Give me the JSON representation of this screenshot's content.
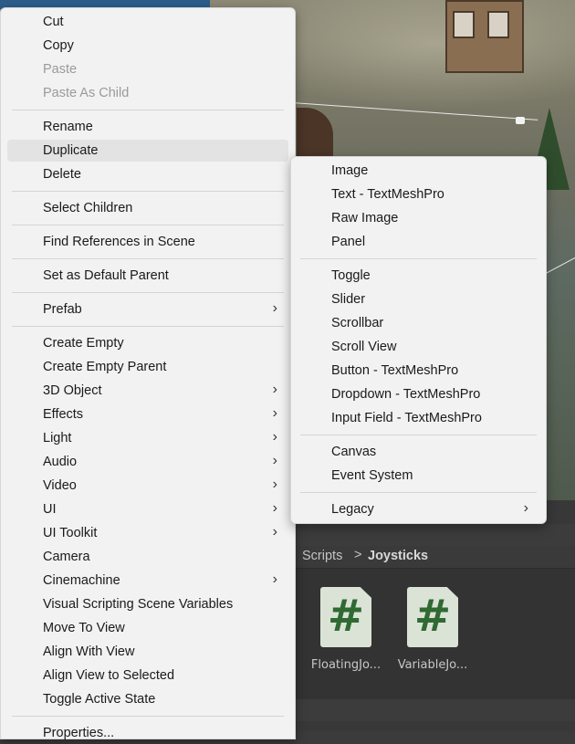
{
  "context_menu": {
    "items": [
      {
        "label": "Cut",
        "disabled": false,
        "submenu": false
      },
      {
        "label": "Copy",
        "disabled": false,
        "submenu": false
      },
      {
        "label": "Paste",
        "disabled": true,
        "submenu": false
      },
      {
        "label": "Paste As Child",
        "disabled": true,
        "submenu": false
      },
      {
        "label": "Rename",
        "disabled": false,
        "submenu": false
      },
      {
        "label": "Duplicate",
        "disabled": false,
        "submenu": false,
        "highlighted": true
      },
      {
        "label": "Delete",
        "disabled": false,
        "submenu": false
      },
      {
        "label": "Select Children",
        "disabled": false,
        "submenu": false
      },
      {
        "label": "Find References in Scene",
        "disabled": false,
        "submenu": false
      },
      {
        "label": "Set as Default Parent",
        "disabled": false,
        "submenu": false
      },
      {
        "label": "Prefab",
        "disabled": false,
        "submenu": true
      },
      {
        "label": "Create Empty",
        "disabled": false,
        "submenu": false
      },
      {
        "label": "Create Empty Parent",
        "disabled": false,
        "submenu": false
      },
      {
        "label": "3D Object",
        "disabled": false,
        "submenu": true
      },
      {
        "label": "Effects",
        "disabled": false,
        "submenu": true
      },
      {
        "label": "Light",
        "disabled": false,
        "submenu": true
      },
      {
        "label": "Audio",
        "disabled": false,
        "submenu": true
      },
      {
        "label": "Video",
        "disabled": false,
        "submenu": true
      },
      {
        "label": "UI",
        "disabled": false,
        "submenu": true
      },
      {
        "label": "UI Toolkit",
        "disabled": false,
        "submenu": true
      },
      {
        "label": "Camera",
        "disabled": false,
        "submenu": false
      },
      {
        "label": "Cinemachine",
        "disabled": false,
        "submenu": true
      },
      {
        "label": "Visual Scripting Scene Variables",
        "disabled": false,
        "submenu": false
      },
      {
        "label": "Move To View",
        "disabled": false,
        "submenu": false
      },
      {
        "label": "Align With View",
        "disabled": false,
        "submenu": false
      },
      {
        "label": "Align View to Selected",
        "disabled": false,
        "submenu": false
      },
      {
        "label": "Toggle Active State",
        "disabled": false,
        "submenu": false
      },
      {
        "label": "Properties...",
        "disabled": false,
        "submenu": false
      }
    ]
  },
  "ui_submenu": {
    "items": [
      {
        "label": "Image",
        "submenu": false
      },
      {
        "label": "Text - TextMeshPro",
        "submenu": false
      },
      {
        "label": "Raw Image",
        "submenu": false
      },
      {
        "label": "Panel",
        "submenu": false
      },
      {
        "label": "Toggle",
        "submenu": false
      },
      {
        "label": "Slider",
        "submenu": false
      },
      {
        "label": "Scrollbar",
        "submenu": false
      },
      {
        "label": "Scroll View",
        "submenu": false
      },
      {
        "label": "Button - TextMeshPro",
        "submenu": false
      },
      {
        "label": "Dropdown - TextMeshPro",
        "submenu": false
      },
      {
        "label": "Input Field - TextMeshPro",
        "submenu": false
      },
      {
        "label": "Canvas",
        "submenu": false
      },
      {
        "label": "Event System",
        "submenu": false
      },
      {
        "label": "Legacy",
        "submenu": true
      }
    ]
  },
  "project_panel": {
    "breadcrumb": {
      "parent": "Scripts",
      "separator": ">",
      "current": "Joysticks"
    },
    "assets": [
      {
        "icon": "#",
        "name": "FloatingJo..."
      },
      {
        "icon": "#",
        "name": "VariableJo..."
      }
    ]
  },
  "icons": {
    "submenu_arrow": "chevron-right-icon",
    "script_asset": "csharp-script-icon"
  },
  "colors": {
    "menu_bg": "#f2f2f2",
    "highlight": "#e3e3e3",
    "disabled_text": "#9a9a9a",
    "script_icon": "#2f6a33"
  }
}
